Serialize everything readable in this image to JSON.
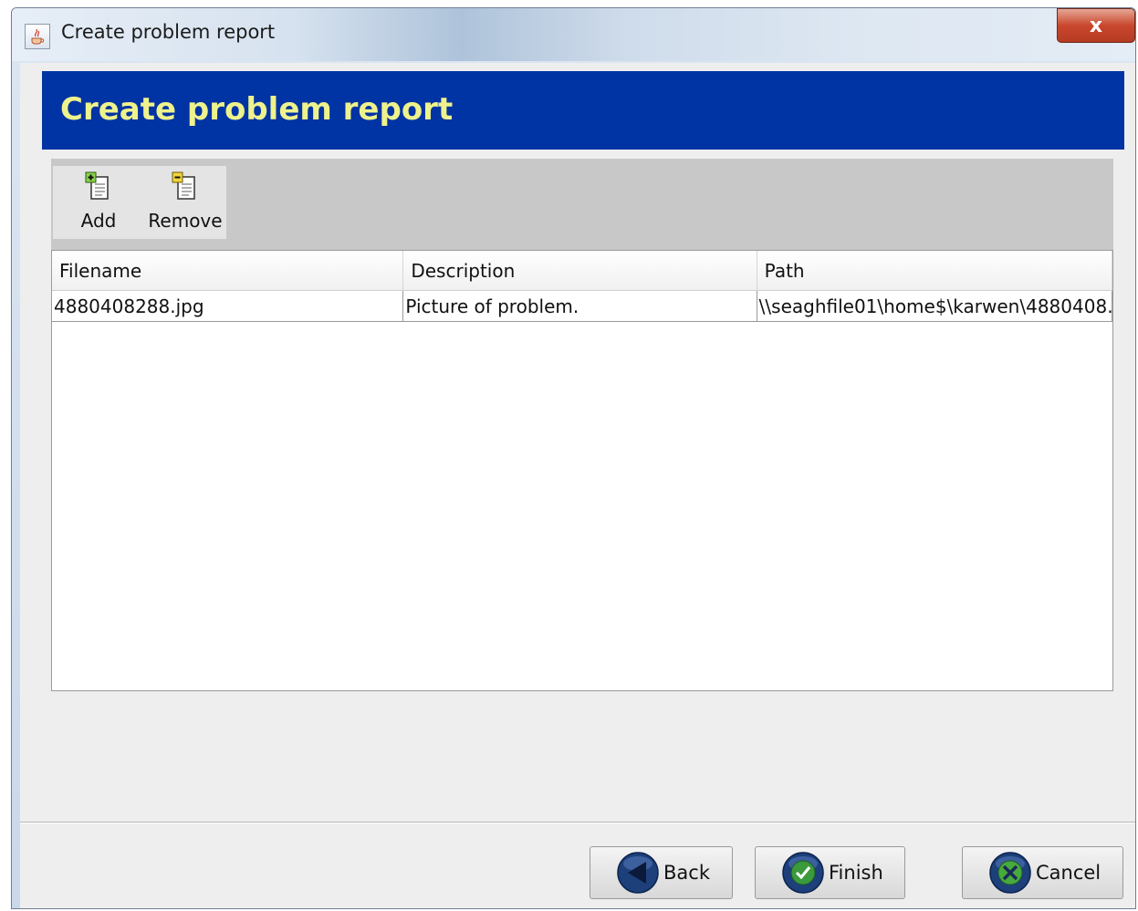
{
  "window": {
    "title": "Create problem report",
    "close_glyph": "x"
  },
  "banner": {
    "title": "Create problem report"
  },
  "toolbar": {
    "add_label": "Add",
    "remove_label": "Remove"
  },
  "table": {
    "columns": [
      "Filename",
      "Description",
      "Path"
    ],
    "rows": [
      [
        "4880408288.jpg",
        "Picture of problem.",
        "\\\\seaghfile01\\home$\\karwen\\4880408…"
      ]
    ]
  },
  "buttons": {
    "back_label": "Back",
    "finish_label": "Finish",
    "cancel_label": "Cancel"
  },
  "colors": {
    "banner_bg": "#0033a3",
    "banner_text": "#eef28c",
    "close_red": "#c9472d"
  },
  "icons": {
    "app": "java-coffee-icon",
    "add": "add-document-icon",
    "remove": "remove-document-icon",
    "back": "back-arrow-icon",
    "finish": "checkmark-icon",
    "cancel": "cancel-x-icon"
  }
}
